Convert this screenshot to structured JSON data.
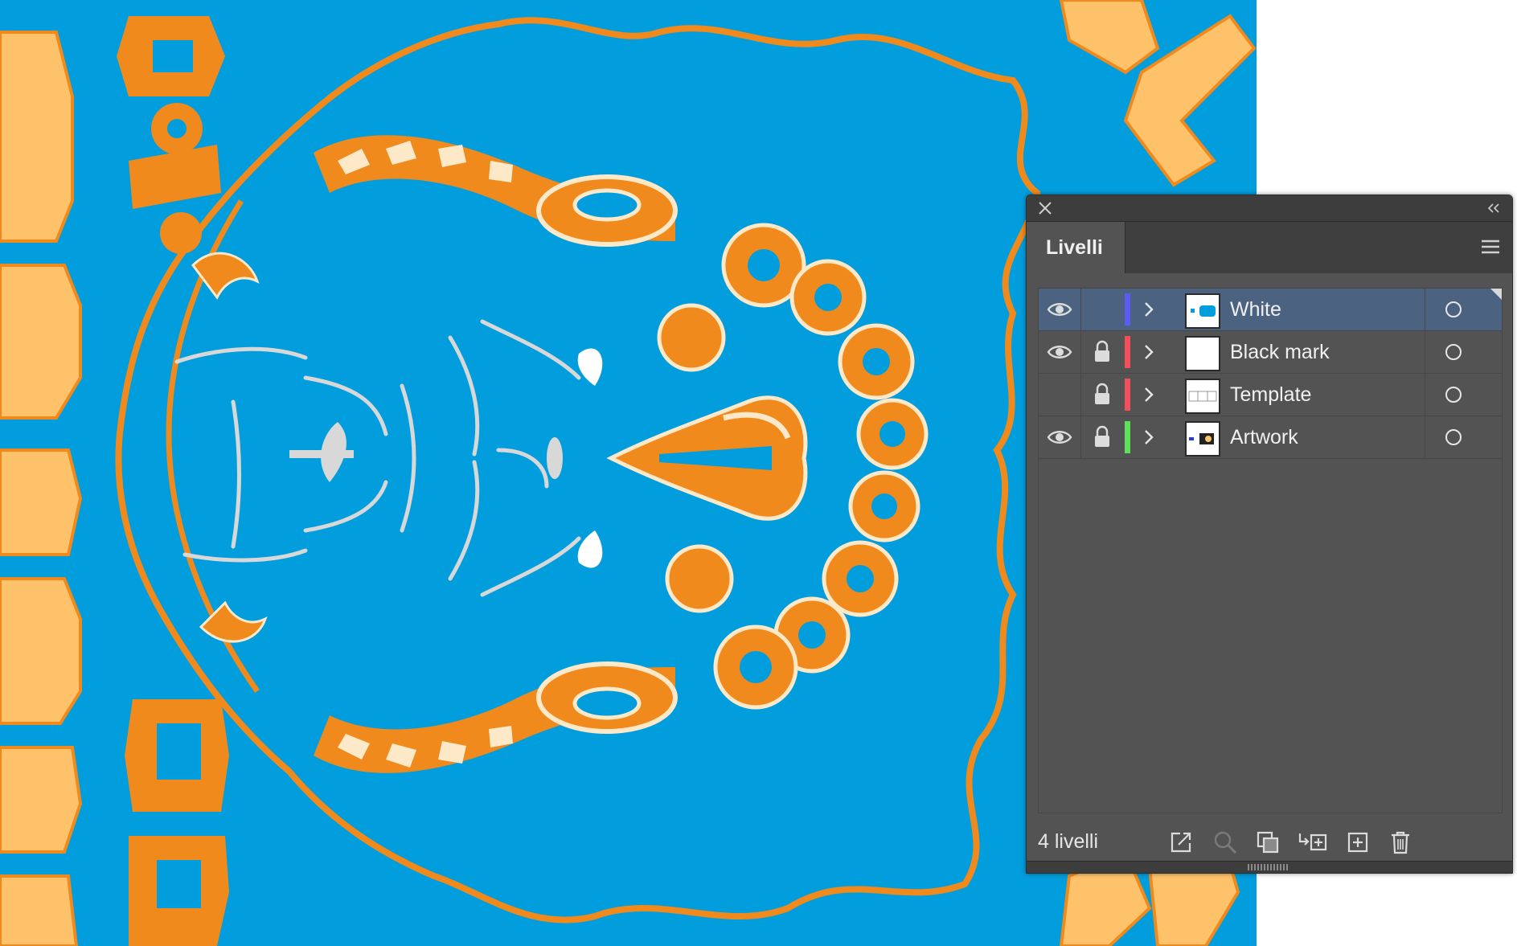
{
  "panel": {
    "tab_label": "Livelli",
    "layer_count_label": "4 livelli"
  },
  "layers": [
    {
      "name": "White",
      "visible": true,
      "locked": false,
      "color": "#5a5cf2",
      "selected": true
    },
    {
      "name": "Black mark",
      "visible": true,
      "locked": true,
      "color": "#f0505a",
      "selected": false
    },
    {
      "name": "Template",
      "visible": false,
      "locked": true,
      "color": "#f0505a",
      "selected": false
    },
    {
      "name": "Artwork",
      "visible": true,
      "locked": true,
      "color": "#5ee05a",
      "selected": false
    }
  ],
  "footer_icons": [
    "export-to-assets-icon",
    "locate-object-icon",
    "make-clipping-mask-icon",
    "create-sublayer-icon",
    "create-new-layer-icon",
    "delete-layer-icon"
  ],
  "colors": {
    "canvas_background": "#029ddd",
    "art_orange": "#f08a1c",
    "art_light_orange": "#fdc26a",
    "art_cream": "#fde8c8",
    "art_grey": "#d8d8d8",
    "panel_bg": "#535353",
    "selected_row": "#4b6380"
  }
}
